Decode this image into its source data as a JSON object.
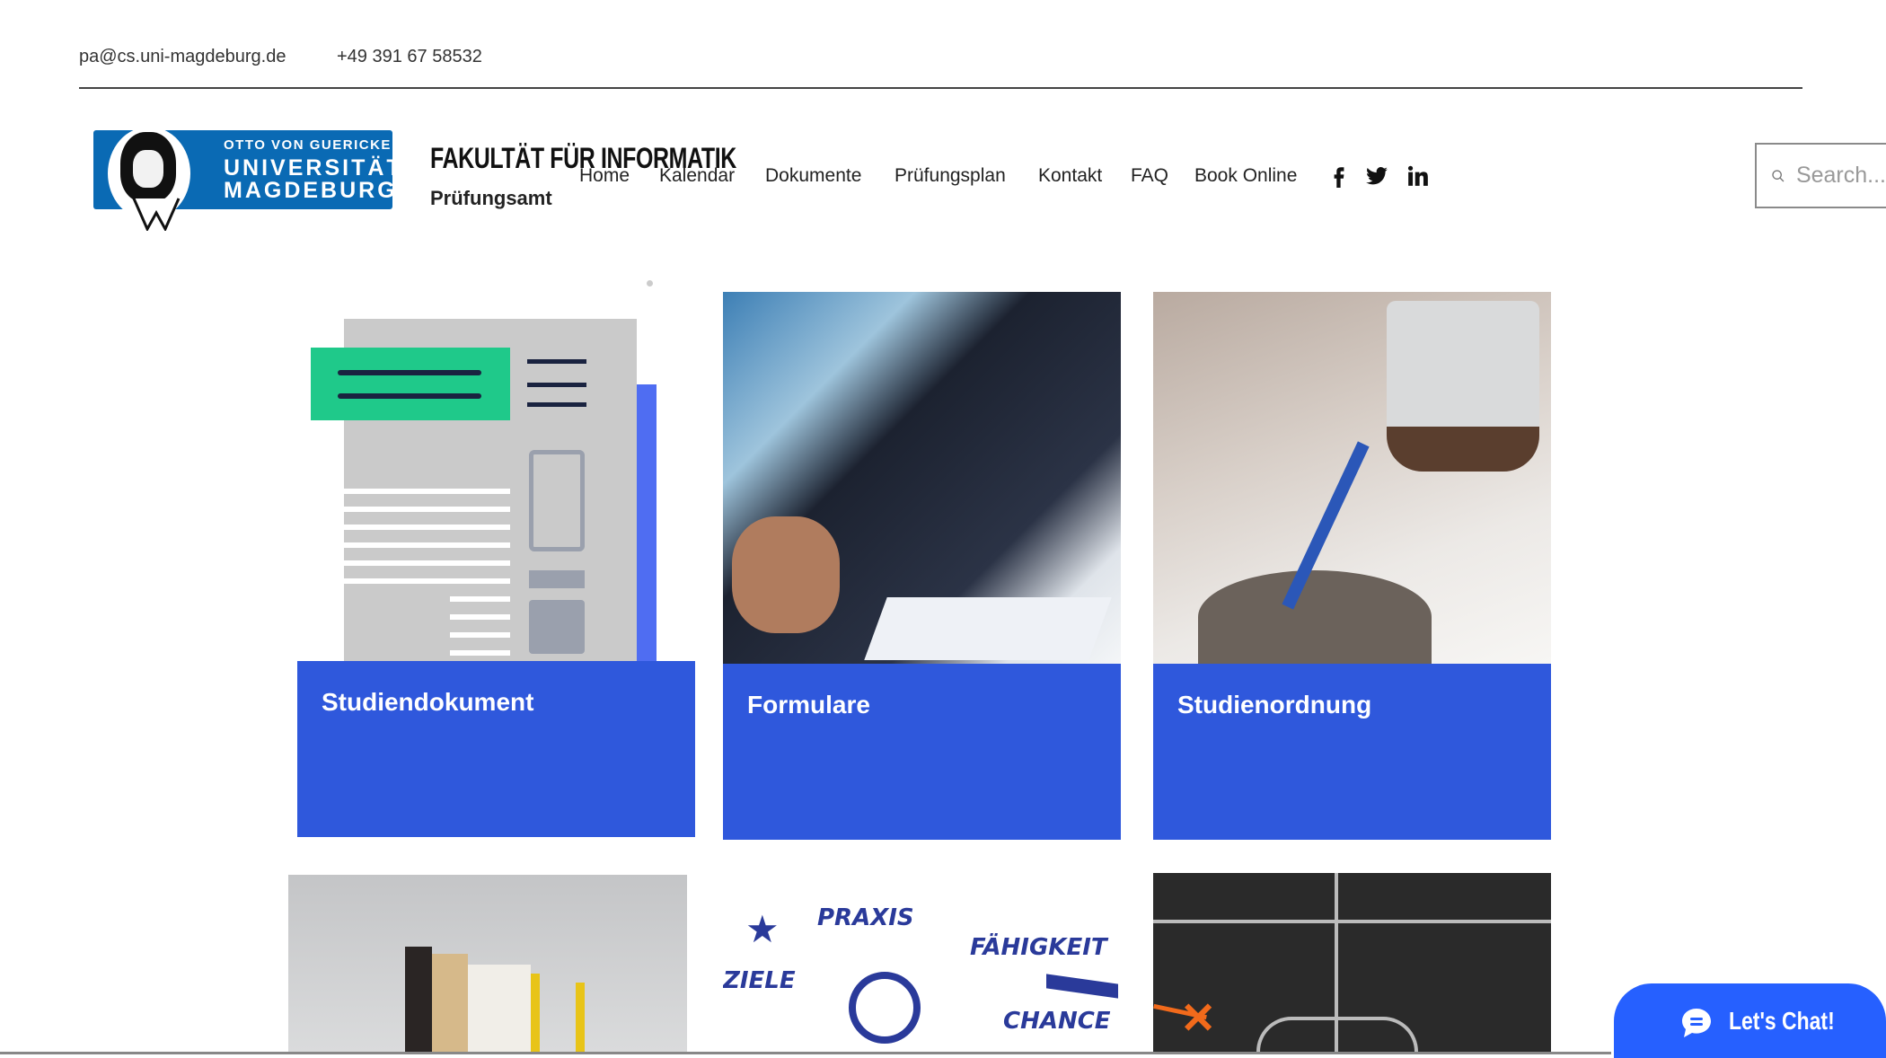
{
  "topbar": {
    "email": "pa@cs.uni-magdeburg.de",
    "phone": "+49 391 67 58532"
  },
  "logo": {
    "line1": "OTTO VON GUERICKE",
    "line2": "UNIVERSITÄT",
    "line3": "MAGDEBURG"
  },
  "header": {
    "title": "FAKULTÄT FÜR INFORMATIK",
    "subtitle": "Prüfungsamt"
  },
  "nav": [
    "Home",
    "Kalendar",
    "Dokumente",
    "Prüfungsplan",
    "Kontakt",
    "FAQ",
    "Book Online"
  ],
  "social": [
    "facebook-icon",
    "twitter-icon",
    "linkedin-icon"
  ],
  "search": {
    "placeholder": "Search..."
  },
  "cards": [
    {
      "title": "Studiendokument"
    },
    {
      "title": "Formulare"
    },
    {
      "title": "Studienordnung"
    }
  ],
  "row2_image_text": {
    "praxis": "PRAXIS",
    "ziele": "ZIELE",
    "faehigkeit": "FÄHIGKEIT",
    "chance": "CHANCE"
  },
  "chat": {
    "label": "Let's Chat!"
  },
  "colors": {
    "card_blue": "#2F58DC",
    "chat_blue": "#2660FF",
    "logo_blue": "#0A6AB4",
    "accent_green": "#1FC98A"
  }
}
